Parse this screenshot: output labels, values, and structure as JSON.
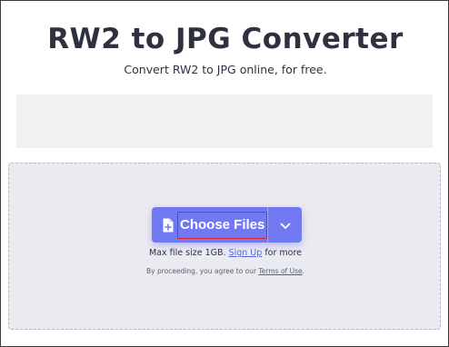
{
  "page": {
    "title": "RW2 to JPG Converter",
    "subtitle": "Convert RW2 to JPG online, for free."
  },
  "uploader": {
    "choose_label": "Choose Files",
    "max_size_prefix": "Max file size 1GB.",
    "signup_link": "Sign Up",
    "max_size_suffix": "for more",
    "terms_prefix": "By proceeding, you agree to our",
    "terms_link": "Terms of Use",
    "terms_suffix": "."
  },
  "icons": {
    "file": "file-plus-icon",
    "dropdown": "chevron-down-icon"
  },
  "colors": {
    "accent": "#7179f2",
    "dropzone_bg": "#eaeaf1",
    "highlight_border": "#e0202a"
  }
}
